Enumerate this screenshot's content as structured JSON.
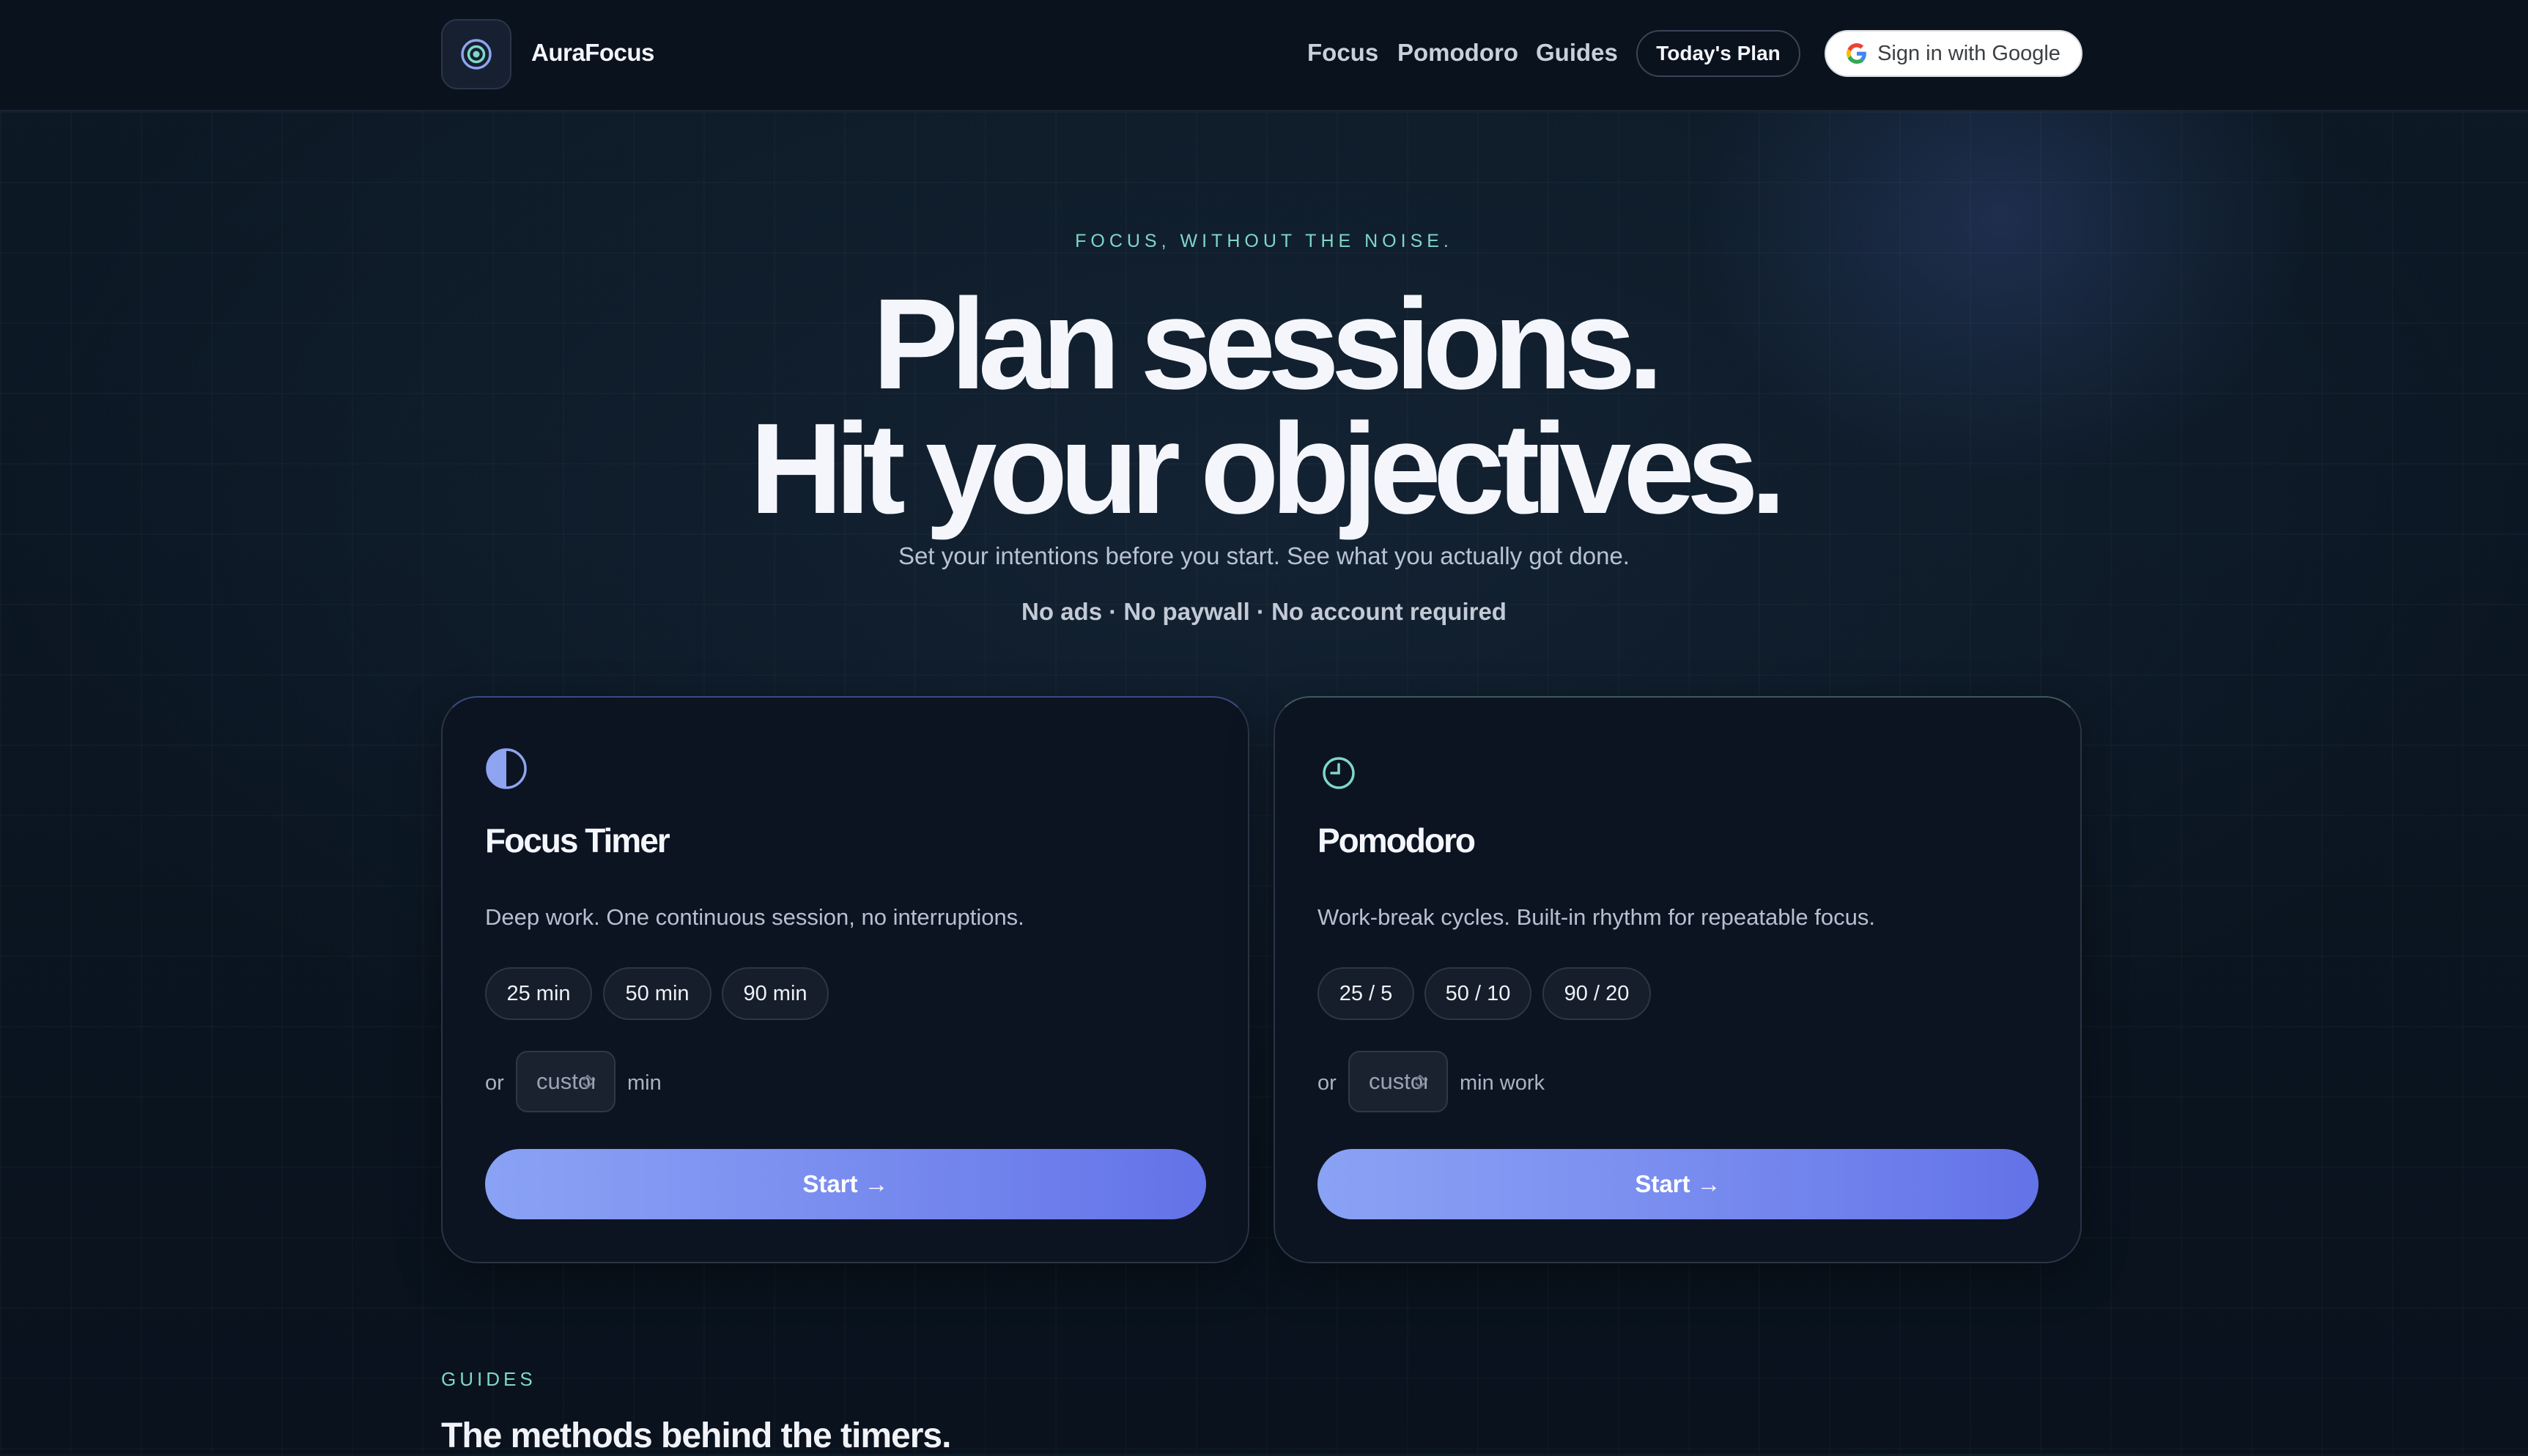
{
  "header": {
    "brand": "AuraFocus",
    "nav": [
      "Focus",
      "Pomodoro",
      "Guides"
    ],
    "plan_button": "Today's Plan",
    "google_button": "Sign in with Google"
  },
  "hero": {
    "eyebrow": "FOCUS, WITHOUT THE NOISE.",
    "title_line1": "Plan sessions.",
    "title_line2": "Hit your objectives.",
    "subtitle": "Set your intentions before you start. See what you actually got done.",
    "badges": "No ads · No paywall · No account required"
  },
  "cards": [
    {
      "icon": "half-circle-icon",
      "title": "Focus Timer",
      "description": "Deep work. One continuous session, no interruptions.",
      "presets": [
        "25 min",
        "50 min",
        "90 min"
      ],
      "or_label": "or",
      "custom_placeholder": "custom",
      "unit": "min",
      "start": "Start →"
    },
    {
      "icon": "clock-icon",
      "title": "Pomodoro",
      "description": "Work-break cycles. Built-in rhythm for repeatable focus.",
      "presets": [
        "25 / 5",
        "50 / 10",
        "90 / 20"
      ],
      "or_label": "or",
      "custom_placeholder": "custom",
      "unit": "min work",
      "start": "Start →"
    }
  ],
  "guides": {
    "eyebrow": "GUIDES",
    "title": "The methods behind the timers."
  },
  "colors": {
    "accent_teal": "#7fd8c7",
    "accent_indigo": "#6373e8",
    "background": "#0b1622"
  }
}
